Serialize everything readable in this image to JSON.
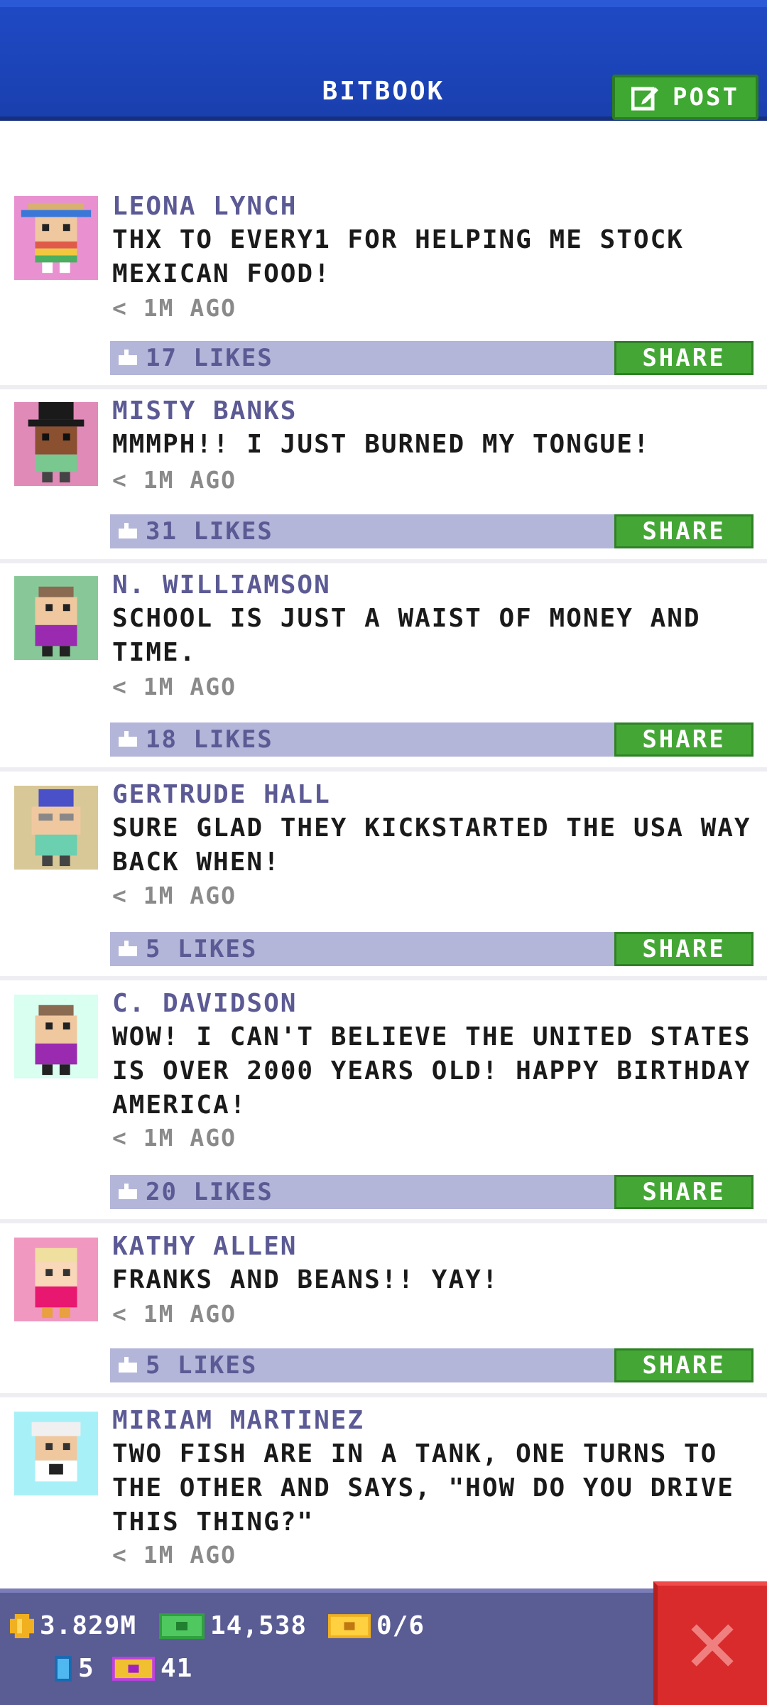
{
  "header": {
    "title": "BITBOOK",
    "post_label": "POST"
  },
  "posts": [
    {
      "author": "LEONA LYNCH",
      "message": "THX TO EVERY1 FOR HELPING ME STOCK MEXICAN FOOD!",
      "time": "< 1M AGO",
      "likes": "17 LIKES",
      "share": "SHARE",
      "avatar": "sombrero-woman-avatar",
      "avatar_bg": "#e890d0"
    },
    {
      "author": "MISTY BANKS",
      "message": "MMMPH!! I JUST BURNED MY TONGUE!",
      "time": "< 1M AGO",
      "likes": "31 LIKES",
      "share": "SHARE",
      "avatar": "top-hat-avatar",
      "avatar_bg": "#e08ab8"
    },
    {
      "author": "N. WILLIAMSON",
      "message": "SCHOOL IS JUST A WAIST OF MONEY AND TIME.",
      "time": "< 1M AGO",
      "likes": "18 LIKES",
      "share": "SHARE",
      "avatar": "purple-shirt-avatar",
      "avatar_bg": "#88c898"
    },
    {
      "author": "GERTRUDE HALL",
      "message": "SURE GLAD THEY KICKSTARTED THE USA WAY BACK WHEN!",
      "time": "< 1M AGO",
      "likes": "5 LIKES",
      "share": "SHARE",
      "avatar": "blue-hair-granny-avatar",
      "avatar_bg": "#d8c898"
    },
    {
      "author": "C. DAVIDSON",
      "message": "WOW! I CAN'T BELIEVE THE UNITED STATES IS OVER 2000 YEARS OLD! HAPPY BIRTHDAY AMERICA!",
      "time": "< 1M AGO",
      "likes": "20 LIKES",
      "share": "SHARE",
      "avatar": "purple-shirt-avatar",
      "avatar_bg": "#d8fff0"
    },
    {
      "author": "KATHY ALLEN",
      "message": "FRANKS AND BEANS!! YAY!",
      "time": "< 1M AGO",
      "likes": "5 LIKES",
      "share": "SHARE",
      "avatar": "blonde-avatar",
      "avatar_bg": "#f098c0"
    },
    {
      "author": "MIRIAM MARTINEZ",
      "message": "TWO FISH ARE IN A TANK, ONE TURNS TO THE OTHER AND SAYS, \"HOW DO YOU DRIVE THIS THING?\"",
      "time": "< 1M AGO",
      "likes": "",
      "share": "",
      "avatar": "white-hair-avatar",
      "avatar_bg": "#a8f0f8"
    }
  ],
  "stats": {
    "coins": "3.829M",
    "bux": "14,538",
    "tickets": "0/6",
    "elevators": "5",
    "vip": "41"
  },
  "colors": {
    "header": "#1f49c4",
    "accent_green": "#44a735",
    "bar": "#b3b5d9",
    "name": "#5c5a94",
    "close": "#d92b2b"
  }
}
